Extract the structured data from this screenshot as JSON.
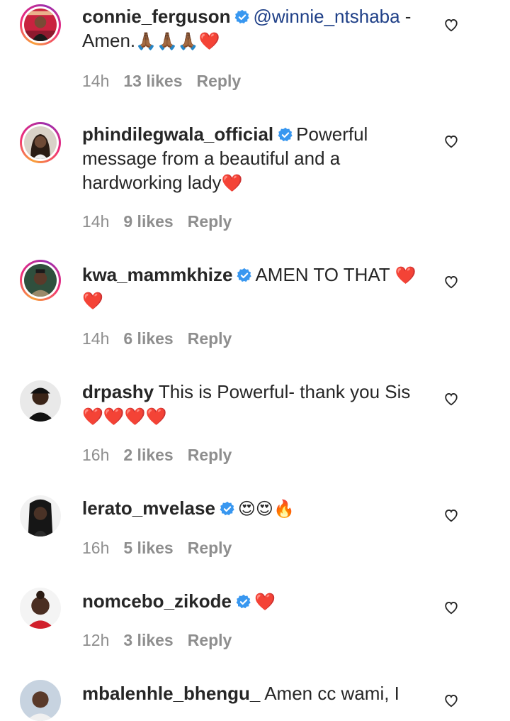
{
  "comments": [
    {
      "username": "connie_ferguson",
      "verified": true,
      "mention": "@winnie_ntshaba",
      "text_after_mention": " -",
      "text": "Amen.",
      "emoji_after": "🙏🏾🙏🏾🙏🏾❤️",
      "time": "14h",
      "likes": "13 likes",
      "reply": "Reply",
      "avatar_ring": true
    },
    {
      "username": "phindilegwala_official",
      "verified": true,
      "text": "Powerful message from a beautiful and a hardworking lady",
      "emoji_after": "❤️",
      "time": "14h",
      "likes": "9 likes",
      "reply": "Reply",
      "avatar_ring": true
    },
    {
      "username": "kwa_mammkhize",
      "verified": true,
      "text": "AMEN TO THAT",
      "emoji_after": "❤️❤️",
      "time": "14h",
      "likes": "6 likes",
      "reply": "Reply",
      "avatar_ring": true
    },
    {
      "username": "drpashy",
      "verified": false,
      "text": "This is Powerful- thank you Sis",
      "emoji_after": "❤️❤️❤️❤️",
      "time": "16h",
      "likes": "2 likes",
      "reply": "Reply",
      "avatar_ring": false
    },
    {
      "username": "lerato_mvelase",
      "verified": true,
      "text": "",
      "emoji_after": "😍😍🔥",
      "time": "16h",
      "likes": "5 likes",
      "reply": "Reply",
      "avatar_ring": false
    },
    {
      "username": "nomcebo_zikode",
      "verified": true,
      "text": "",
      "emoji_after": "❤️",
      "time": "12h",
      "likes": "3 likes",
      "reply": "Reply",
      "avatar_ring": false
    },
    {
      "username": "mbalenhle_bhengu_",
      "verified": false,
      "text": "Amen cc wami, I",
      "time": "",
      "likes": "",
      "reply": "",
      "avatar_ring": false
    }
  ],
  "colors": {
    "text": "#262626",
    "meta": "#8e8e8e",
    "verified": "#3897f0",
    "mention": "#1e3f87",
    "heart": "#ed1c24"
  },
  "icons": {
    "like": "heart-outline-icon",
    "verified": "verified-badge-icon"
  }
}
